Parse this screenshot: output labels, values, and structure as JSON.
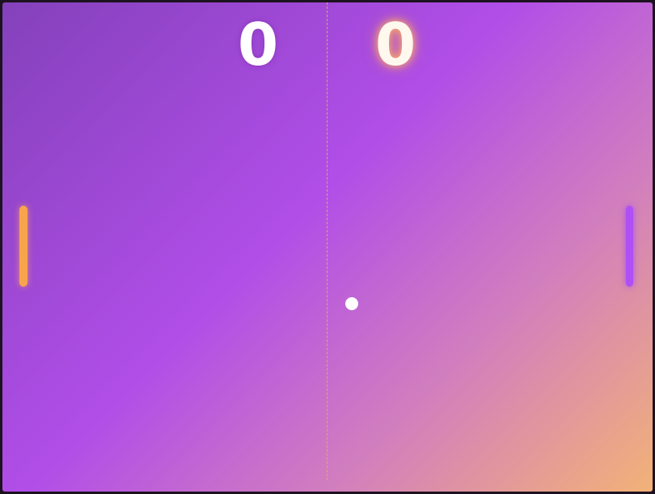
{
  "game": {
    "title": "",
    "scores": {
      "left": "0",
      "right": "0"
    },
    "colors": {
      "left_paddle": "#f7a44d",
      "right_paddle": "#b04ff5",
      "ball": "#ffffff",
      "net": "#f0a860",
      "background_start": "#8441bb",
      "background_end": "#f2b277"
    },
    "icons": {
      "ball": "ball",
      "left_paddle": "paddle",
      "right_paddle": "paddle"
    }
  }
}
